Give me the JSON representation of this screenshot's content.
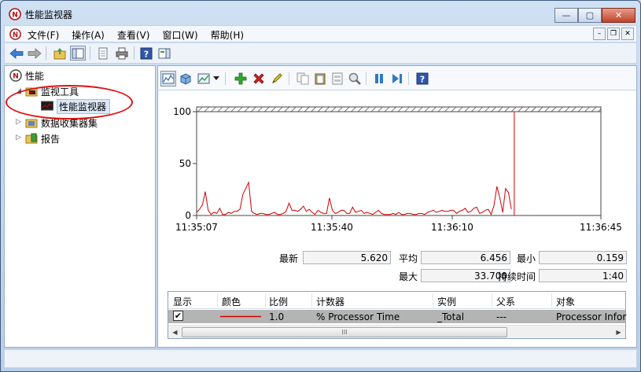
{
  "window": {
    "title": "性能监视器",
    "buttons": {
      "minimize": "—",
      "maximize": "▢",
      "close": "✕"
    }
  },
  "menu": {
    "items": [
      "文件(F)",
      "操作(A)",
      "查看(V)",
      "窗口(W)",
      "帮助(H)"
    ],
    "mdi": {
      "minimize": "–",
      "restore": "❐",
      "close": "✕"
    }
  },
  "tree": {
    "root": "性能",
    "monitor_tools": "监视工具",
    "perf_monitor": "性能监视器",
    "data_collector_sets": "数据收集器集",
    "reports": "报告"
  },
  "colors": {
    "series": "#d40000",
    "accent": "#3a6fb0",
    "annotation": "#e01010"
  },
  "chart_data": {
    "type": "line",
    "ylim": [
      0,
      100
    ],
    "yticks": [
      "100",
      "50",
      "0"
    ],
    "xticks": [
      "11:35:07",
      "11:35:40",
      "11:36:10",
      "11:36:45"
    ],
    "series": [
      {
        "name": "% Processor Time",
        "values": [
          3,
          6,
          10,
          23,
          5,
          1,
          3,
          2,
          7,
          1,
          1,
          3,
          2,
          4,
          4,
          6,
          20,
          26,
          32,
          4,
          2,
          1,
          2,
          2,
          1,
          1,
          2,
          3,
          1,
          1,
          2,
          4,
          12,
          5,
          5,
          4,
          6,
          9,
          4,
          6,
          3,
          1,
          5,
          3,
          2,
          2,
          17,
          5,
          2,
          3,
          5,
          5,
          2,
          2,
          8,
          3,
          4,
          5,
          2,
          3,
          2,
          1,
          3,
          5,
          2,
          1,
          1,
          1,
          2,
          1,
          3,
          1,
          1,
          2,
          2,
          1,
          1,
          2,
          2,
          1,
          3,
          4,
          5,
          3,
          4,
          5,
          4,
          4,
          5,
          5,
          2,
          4,
          5,
          7,
          3,
          4,
          7,
          8,
          2,
          3,
          5,
          6,
          1,
          10,
          28,
          17,
          3,
          26,
          22,
          6
        ]
      }
    ],
    "marker_index": 110
  },
  "stats": {
    "latest_label": "最新",
    "latest": "5.620",
    "avg_label": "平均",
    "avg": "6.456",
    "min_label": "最小",
    "min": "0.159",
    "max_label": "最大",
    "max": "33.700",
    "duration_label": "持续时间",
    "duration": "1:40"
  },
  "counters": {
    "headers": [
      "显示",
      "颜色",
      "比例",
      "计数器",
      "实例",
      "父系",
      "对象"
    ],
    "row": {
      "checked": "✔",
      "scale": "1.0",
      "counter": "% Processor Time",
      "instance": "_Total",
      "parent": "---",
      "object": "Processor Infor"
    },
    "scroll_grip": "III"
  }
}
